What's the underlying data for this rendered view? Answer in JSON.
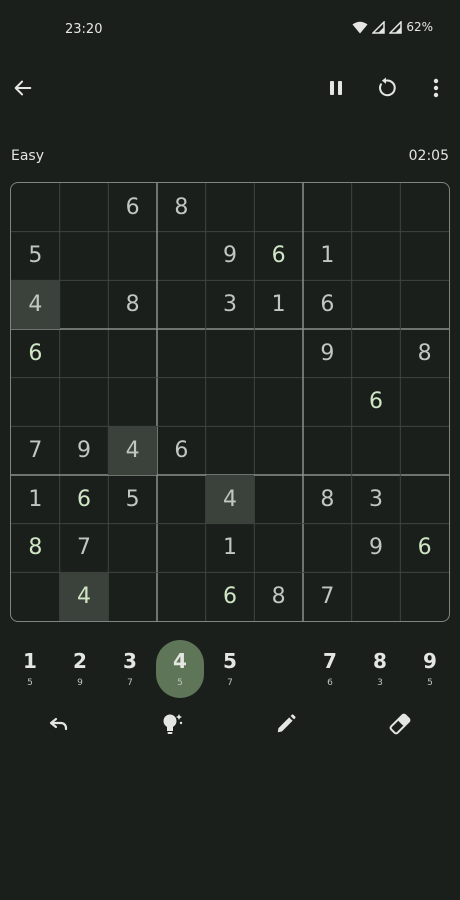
{
  "status_bar": {
    "time": "23:20",
    "battery": "62%",
    "icons": [
      "wifi-icon",
      "signal-icon",
      "signal-icon",
      "battery-text"
    ]
  },
  "app_bar": {
    "icons": [
      "back-arrow-icon",
      "pause-icon",
      "restart-icon",
      "more-vert-icon"
    ]
  },
  "game": {
    "difficulty": "Easy",
    "timer": "02:05"
  },
  "board": {
    "rows": [
      [
        "",
        "",
        "6",
        "8",
        "",
        "",
        "",
        "",
        ""
      ],
      [
        "5",
        "",
        "",
        "",
        "9",
        "6",
        "1",
        "",
        ""
      ],
      [
        "4",
        "",
        "8",
        "",
        "3",
        "1",
        "6",
        "",
        ""
      ],
      [
        "6",
        "",
        "",
        "",
        "",
        "",
        "9",
        "",
        "8"
      ],
      [
        "",
        "",
        "",
        "",
        "",
        "",
        "",
        "6",
        ""
      ],
      [
        "7",
        "9",
        "4",
        "6",
        "",
        "",
        "",
        "",
        ""
      ],
      [
        "1",
        "6",
        "5",
        "",
        "4",
        "",
        "8",
        "3",
        ""
      ],
      [
        "8",
        "7",
        "",
        "",
        "1",
        "",
        "",
        "9",
        "6"
      ],
      [
        "",
        "4",
        "",
        "",
        "6",
        "8",
        "7",
        "",
        ""
      ]
    ],
    "user_entries": [
      [
        1,
        5
      ],
      [
        3,
        0
      ],
      [
        4,
        7
      ],
      [
        6,
        1
      ],
      [
        7,
        0
      ],
      [
        7,
        8
      ],
      [
        8,
        1
      ],
      [
        8,
        4
      ]
    ],
    "highlighted": [
      [
        2,
        0
      ],
      [
        5,
        2
      ],
      [
        6,
        4
      ],
      [
        8,
        1
      ]
    ],
    "colors": {
      "given": "#c2c6c0",
      "user": "#cfe6c4",
      "highlight": "#3b423c",
      "selected": "#5e7557"
    }
  },
  "numpad": [
    {
      "digit": "1",
      "count": "5"
    },
    {
      "digit": "2",
      "count": "9"
    },
    {
      "digit": "3",
      "count": "7"
    },
    {
      "digit": "4",
      "count": "5",
      "selected": true
    },
    {
      "digit": "5",
      "count": "7"
    },
    {
      "digit": "",
      "count": ""
    },
    {
      "digit": "7",
      "count": "6"
    },
    {
      "digit": "8",
      "count": "3"
    },
    {
      "digit": "9",
      "count": "5"
    }
  ],
  "tools": [
    "undo-icon",
    "hint-icon",
    "pencil-icon",
    "eraser-icon"
  ]
}
